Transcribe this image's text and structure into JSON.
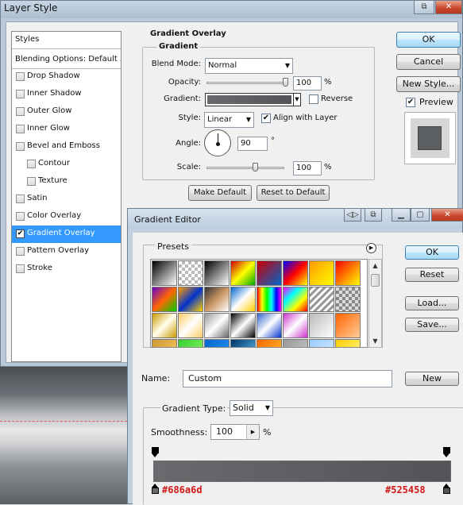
{
  "layer_style": {
    "title": "Layer Style",
    "styles_header": "Styles",
    "blending_options": "Blending Options: Default",
    "items": [
      {
        "label": "Drop Shadow",
        "checked": false,
        "indent": false
      },
      {
        "label": "Inner Shadow",
        "checked": false,
        "indent": false
      },
      {
        "label": "Outer Glow",
        "checked": false,
        "indent": false
      },
      {
        "label": "Inner Glow",
        "checked": false,
        "indent": false
      },
      {
        "label": "Bevel and Emboss",
        "checked": false,
        "indent": false
      },
      {
        "label": "Contour",
        "checked": false,
        "indent": true
      },
      {
        "label": "Texture",
        "checked": false,
        "indent": true
      },
      {
        "label": "Satin",
        "checked": false,
        "indent": false
      },
      {
        "label": "Color Overlay",
        "checked": false,
        "indent": false
      },
      {
        "label": "Gradient Overlay",
        "checked": true,
        "indent": false,
        "selected": true
      },
      {
        "label": "Pattern Overlay",
        "checked": false,
        "indent": false
      },
      {
        "label": "Stroke",
        "checked": false,
        "indent": false
      }
    ],
    "panel": {
      "title": "Gradient Overlay",
      "group_title": "Gradient",
      "blend_mode_label": "Blend Mode:",
      "blend_mode_value": "Normal",
      "opacity_label": "Opacity:",
      "opacity_value": "100",
      "opacity_unit": "%",
      "gradient_label": "Gradient:",
      "reverse_label": "Reverse",
      "reverse_checked": false,
      "style_label": "Style:",
      "style_value": "Linear",
      "align_label": "Align with Layer",
      "align_checked": true,
      "angle_label": "Angle:",
      "angle_value": "90",
      "angle_unit": "°",
      "scale_label": "Scale:",
      "scale_value": "100",
      "scale_unit": "%",
      "make_default": "Make Default",
      "reset_to_default": "Reset to Default"
    },
    "buttons": {
      "ok": "OK",
      "cancel": "Cancel",
      "new_style": "New Style...",
      "preview_label": "Preview",
      "preview_checked": true
    }
  },
  "gradient_editor": {
    "title": "Gradient Editor",
    "presets_label": "Presets",
    "buttons": {
      "ok": "OK",
      "reset": "Reset",
      "load": "Load...",
      "save": "Save...",
      "new": "New"
    },
    "name_label": "Name:",
    "name_value": "Custom",
    "gradient_type_label": "Gradient Type:",
    "gradient_type_value": "Solid",
    "smoothness_label": "Smoothness:",
    "smoothness_value": "100",
    "smoothness_unit": "%",
    "stop_left_color": "#686a6d",
    "stop_right_color": "#525458",
    "stop_left_label": "#686a6d",
    "stop_right_label": "#525458"
  },
  "colors": {
    "selection": "#3399ff",
    "annotation": "#d01818"
  }
}
